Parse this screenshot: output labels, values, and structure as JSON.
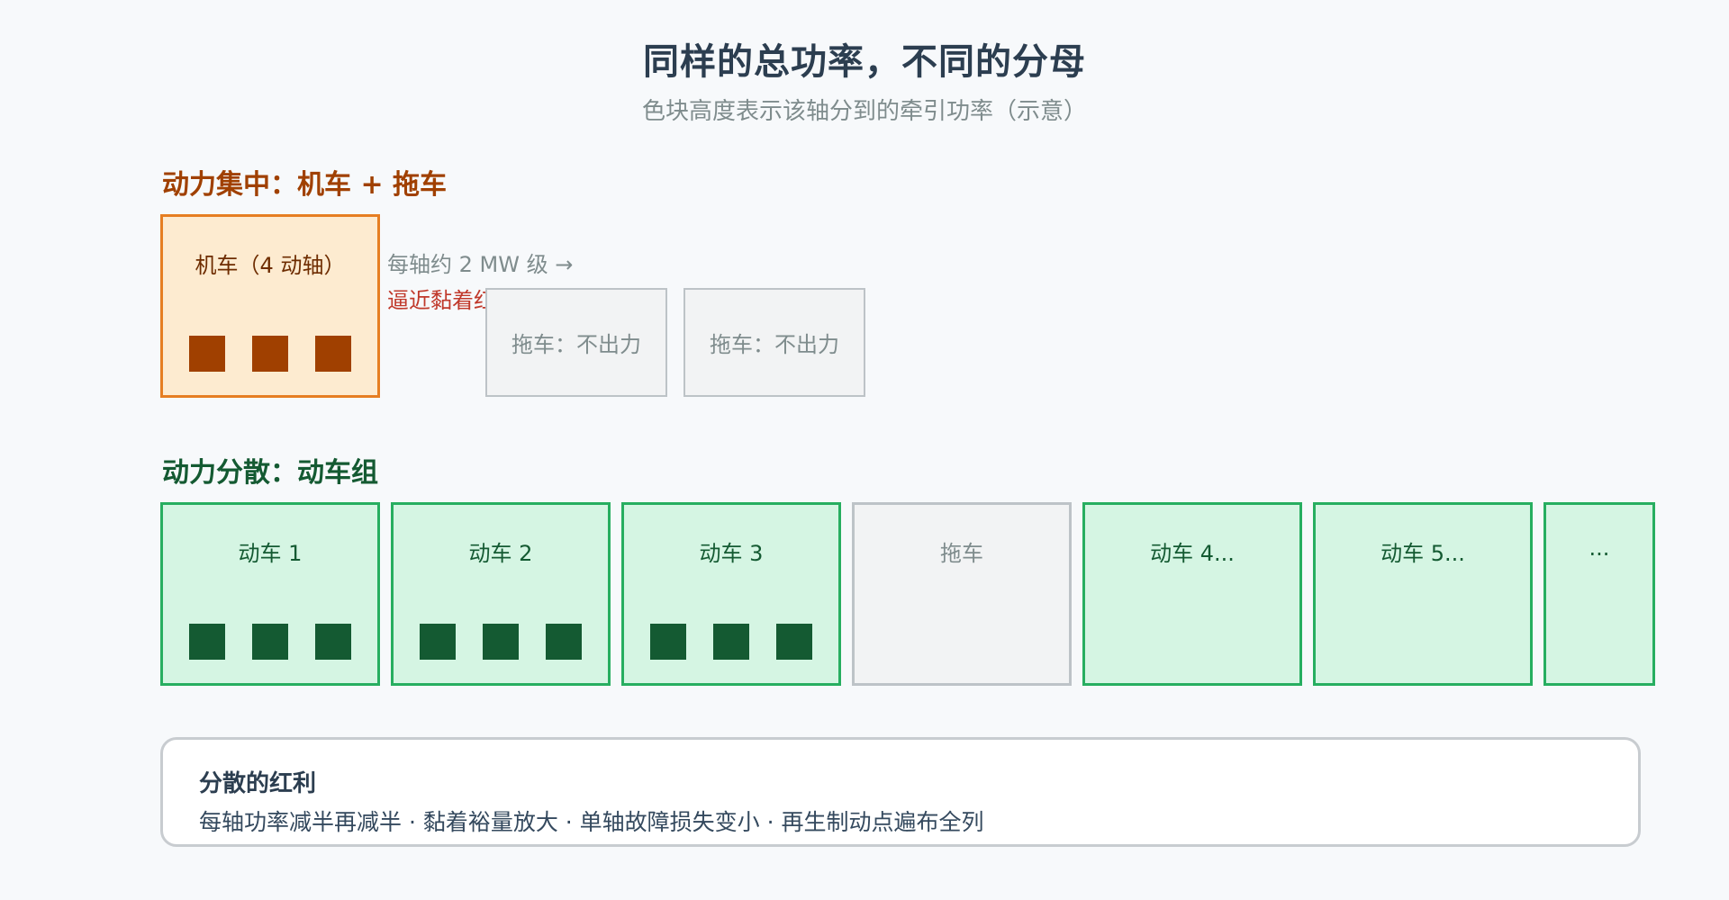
{
  "title": "同样的总功率，不同的分母",
  "subtitle": "色块高度表示该轴分到的牵引功率（示意）",
  "colors": {
    "concentrated_accent": "#a04000",
    "concentrated_border": "#e67e22",
    "concentrated_fill": "#fdebd0",
    "distributed_accent": "#145a32",
    "distributed_border": "#27ae60",
    "distributed_fill": "#d5f5e3",
    "trailer_fill": "#f2f3f4",
    "trailer_border": "#bdc3c7",
    "warning": "#c0392b"
  },
  "concentrated": {
    "heading": "动力集中：机车 + 拖车",
    "locomotive": {
      "label": "机车（4 动轴）",
      "power_blocks": 3
    },
    "note_per_axle": "每轴约 2 MW 级 →",
    "note_adhesion": "逼近黏着红线",
    "trailers": [
      {
        "label": "拖车：不出力"
      },
      {
        "label": "拖车：不出力"
      }
    ]
  },
  "distributed": {
    "heading": "动力分散：动车组",
    "cars": [
      {
        "label": "动车 1",
        "kind": "motor",
        "power_blocks": 3
      },
      {
        "label": "动车 2",
        "kind": "motor",
        "power_blocks": 3
      },
      {
        "label": "动车 3",
        "kind": "motor",
        "power_blocks": 3
      },
      {
        "label": "拖车",
        "kind": "trailer",
        "power_blocks": 0
      },
      {
        "label": "动车 4...",
        "kind": "motor",
        "power_blocks": 0
      },
      {
        "label": "动车 5...",
        "kind": "motor",
        "power_blocks": 0
      },
      {
        "label": "...",
        "kind": "motor",
        "power_blocks": 0
      }
    ]
  },
  "benefits": {
    "title": "分散的红利",
    "body": "每轴功率减半再减半 · 黏着裕量放大 · 单轴故障损失变小 · 再生制动点遍布全列"
  }
}
